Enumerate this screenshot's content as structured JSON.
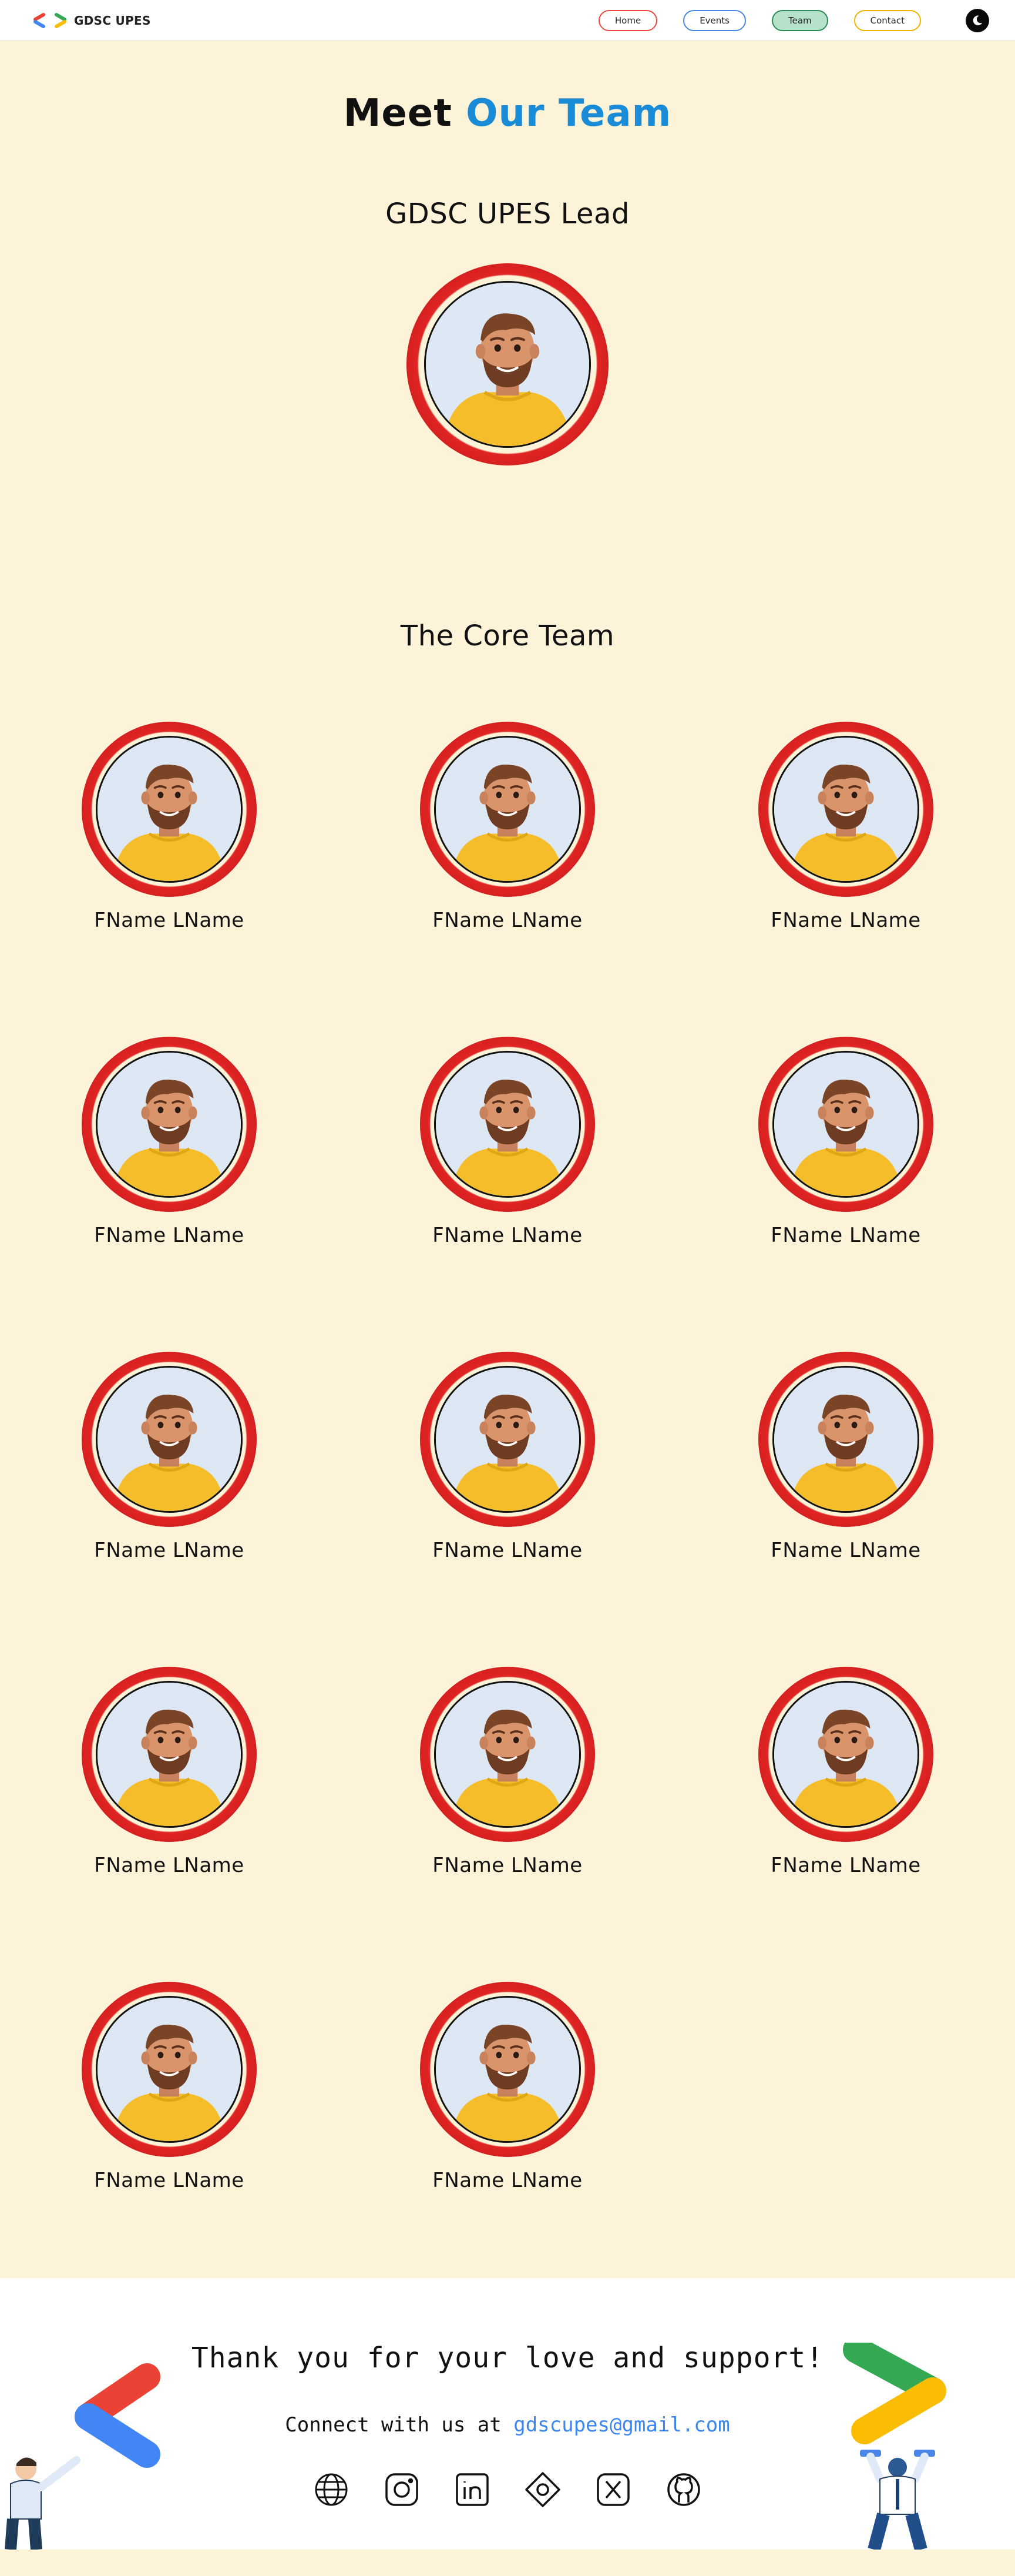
{
  "brand": {
    "name": "GDSC UPES"
  },
  "nav": {
    "links": [
      {
        "label": "Home",
        "color": "#e94b43"
      },
      {
        "label": "Events",
        "color": "#4a86e8"
      },
      {
        "label": "Team",
        "color": "#2e8b57",
        "active": true
      },
      {
        "label": "Contact",
        "color": "#f0b400"
      }
    ],
    "theme_toggle_icon": "moon-icon"
  },
  "page": {
    "title_prefix": "Meet",
    "title_accent": "Our Team",
    "accent_color": "#1a8bd6",
    "background": "#fdf3d8"
  },
  "lead": {
    "title": "GDSC UPES Lead",
    "avatar_icon": "person-avatar-icon"
  },
  "core": {
    "title": "The Core Team",
    "members": [
      {
        "name": "FName LName"
      },
      {
        "name": "FName LName"
      },
      {
        "name": "FName LName"
      },
      {
        "name": "FName LName"
      },
      {
        "name": "FName LName"
      },
      {
        "name": "FName LName"
      },
      {
        "name": "FName LName"
      },
      {
        "name": "FName LName"
      },
      {
        "name": "FName LName"
      },
      {
        "name": "FName LName"
      },
      {
        "name": "FName LName"
      },
      {
        "name": "FName LName"
      },
      {
        "name": "FName LName"
      },
      {
        "name": "FName LName"
      }
    ]
  },
  "footer": {
    "thanks": "Thank you for your love and support!",
    "connect_prefix": "Connect with us at",
    "email": "gdscupes@gmail.com",
    "email_color": "#3b86f0",
    "socials": [
      {
        "icon": "globe-icon"
      },
      {
        "icon": "instagram-icon"
      },
      {
        "icon": "linkedin-icon"
      },
      {
        "icon": "medium-icon"
      },
      {
        "icon": "x-twitter-icon"
      },
      {
        "icon": "github-icon"
      }
    ]
  }
}
